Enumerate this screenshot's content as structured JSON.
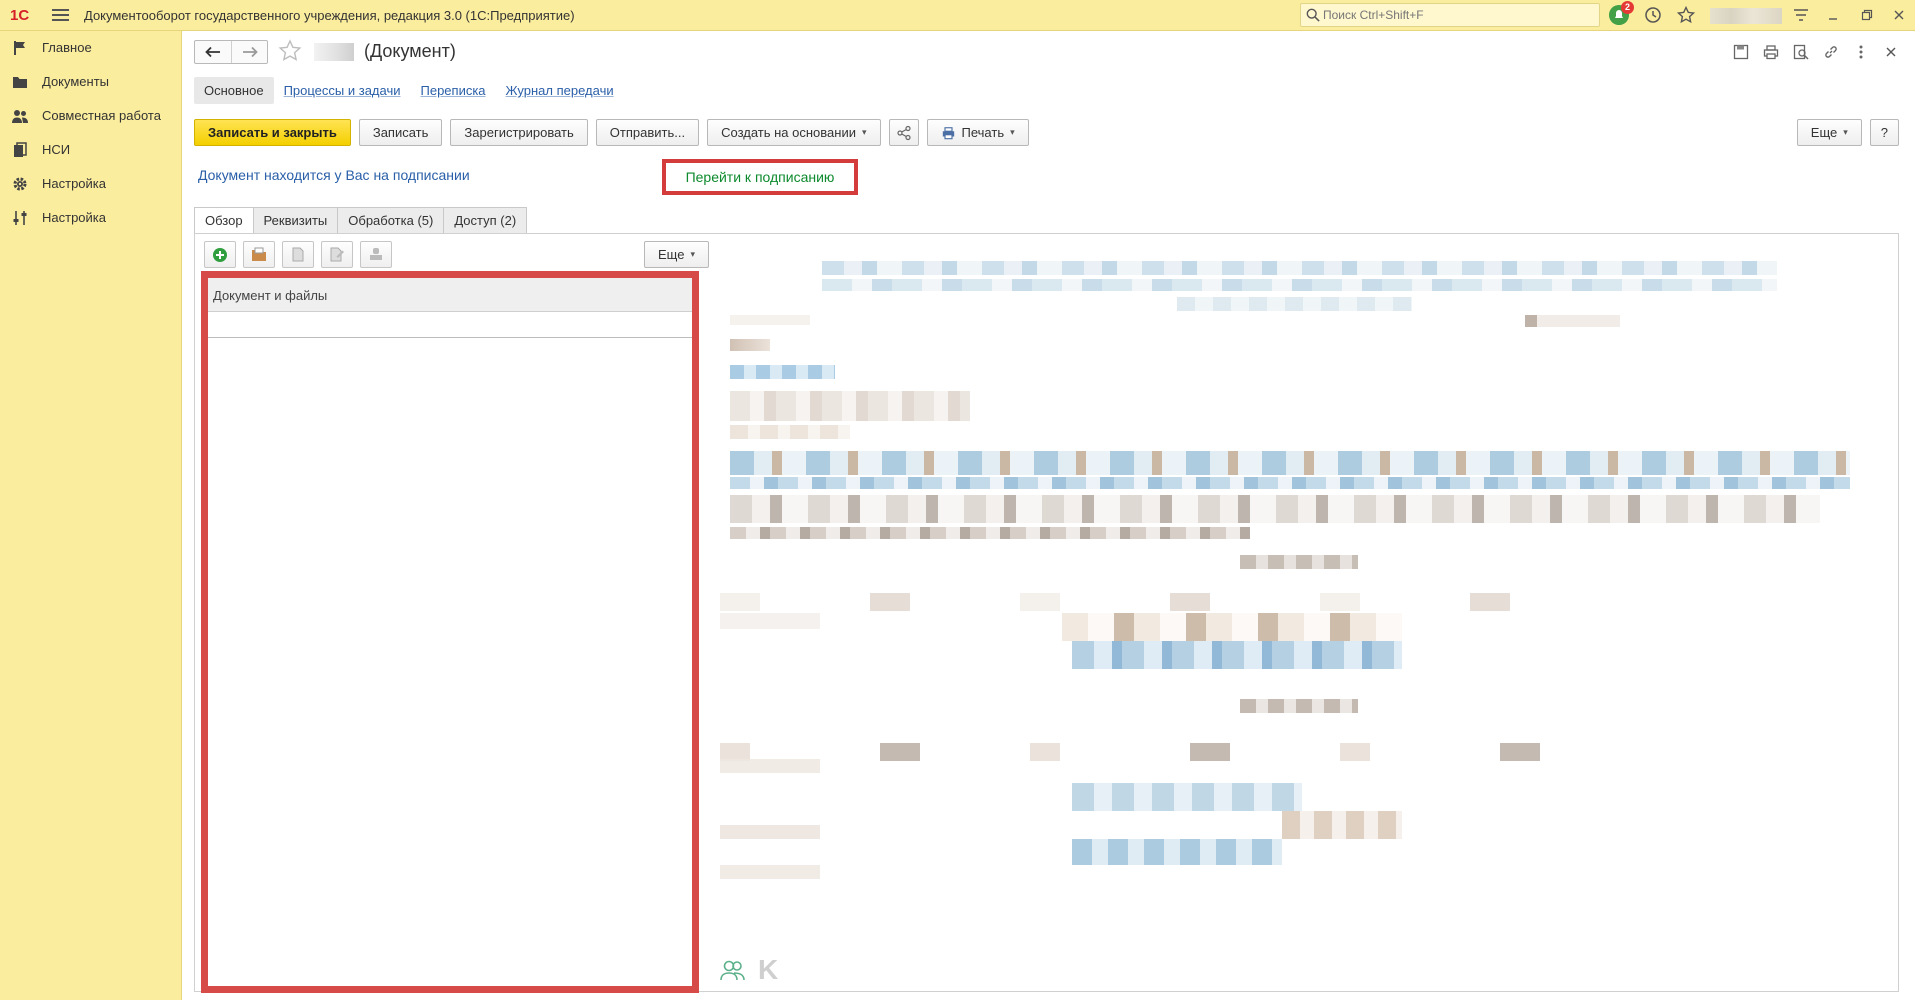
{
  "app": {
    "logo_text": "1С",
    "title": "Документооборот государственного учреждения, редакция 3.0  (1С:Предприятие)",
    "search_placeholder": "Поиск Ctrl+Shift+F",
    "notification_count": "2"
  },
  "sidebar": {
    "items": [
      {
        "label": "Главное",
        "icon": "flag-icon"
      },
      {
        "label": "Документы",
        "icon": "folder-icon"
      },
      {
        "label": "Совместная работа",
        "icon": "users-icon"
      },
      {
        "label": "НСИ",
        "icon": "books-icon"
      },
      {
        "label": "Настройка",
        "icon": "gear-icon"
      },
      {
        "label": "Настройка",
        "icon": "sliders-icon"
      }
    ]
  },
  "document": {
    "title": "(Документ)"
  },
  "sections": {
    "main": "Основное",
    "processes": "Процессы и задачи",
    "correspondence": "Переписка",
    "journal": "Журнал передачи"
  },
  "toolbar": {
    "save_close": "Записать и закрыть",
    "save": "Записать",
    "register": "Зарегистрировать",
    "send": "Отправить...",
    "create_based": "Создать на основании",
    "print": "Печать",
    "more": "Еще",
    "help": "?"
  },
  "signing": {
    "info": "Документ находится у Вас на подписании",
    "goto": "Перейти к подписанию"
  },
  "tabs": {
    "overview": "Обзор",
    "requisites": "Реквизиты",
    "processing": "Обработка (5)",
    "access": "Доступ (2)"
  },
  "files_panel": {
    "more": "Еще",
    "header": "Документ и файлы"
  },
  "preview": {
    "k_label": "K"
  },
  "colors": {
    "sidebar_bg": "#fbed9e",
    "primary_button": "#f4d000",
    "highlight_border": "#d43b3b",
    "link": "#2a5fa8",
    "sign_link": "#0c8a2d"
  }
}
